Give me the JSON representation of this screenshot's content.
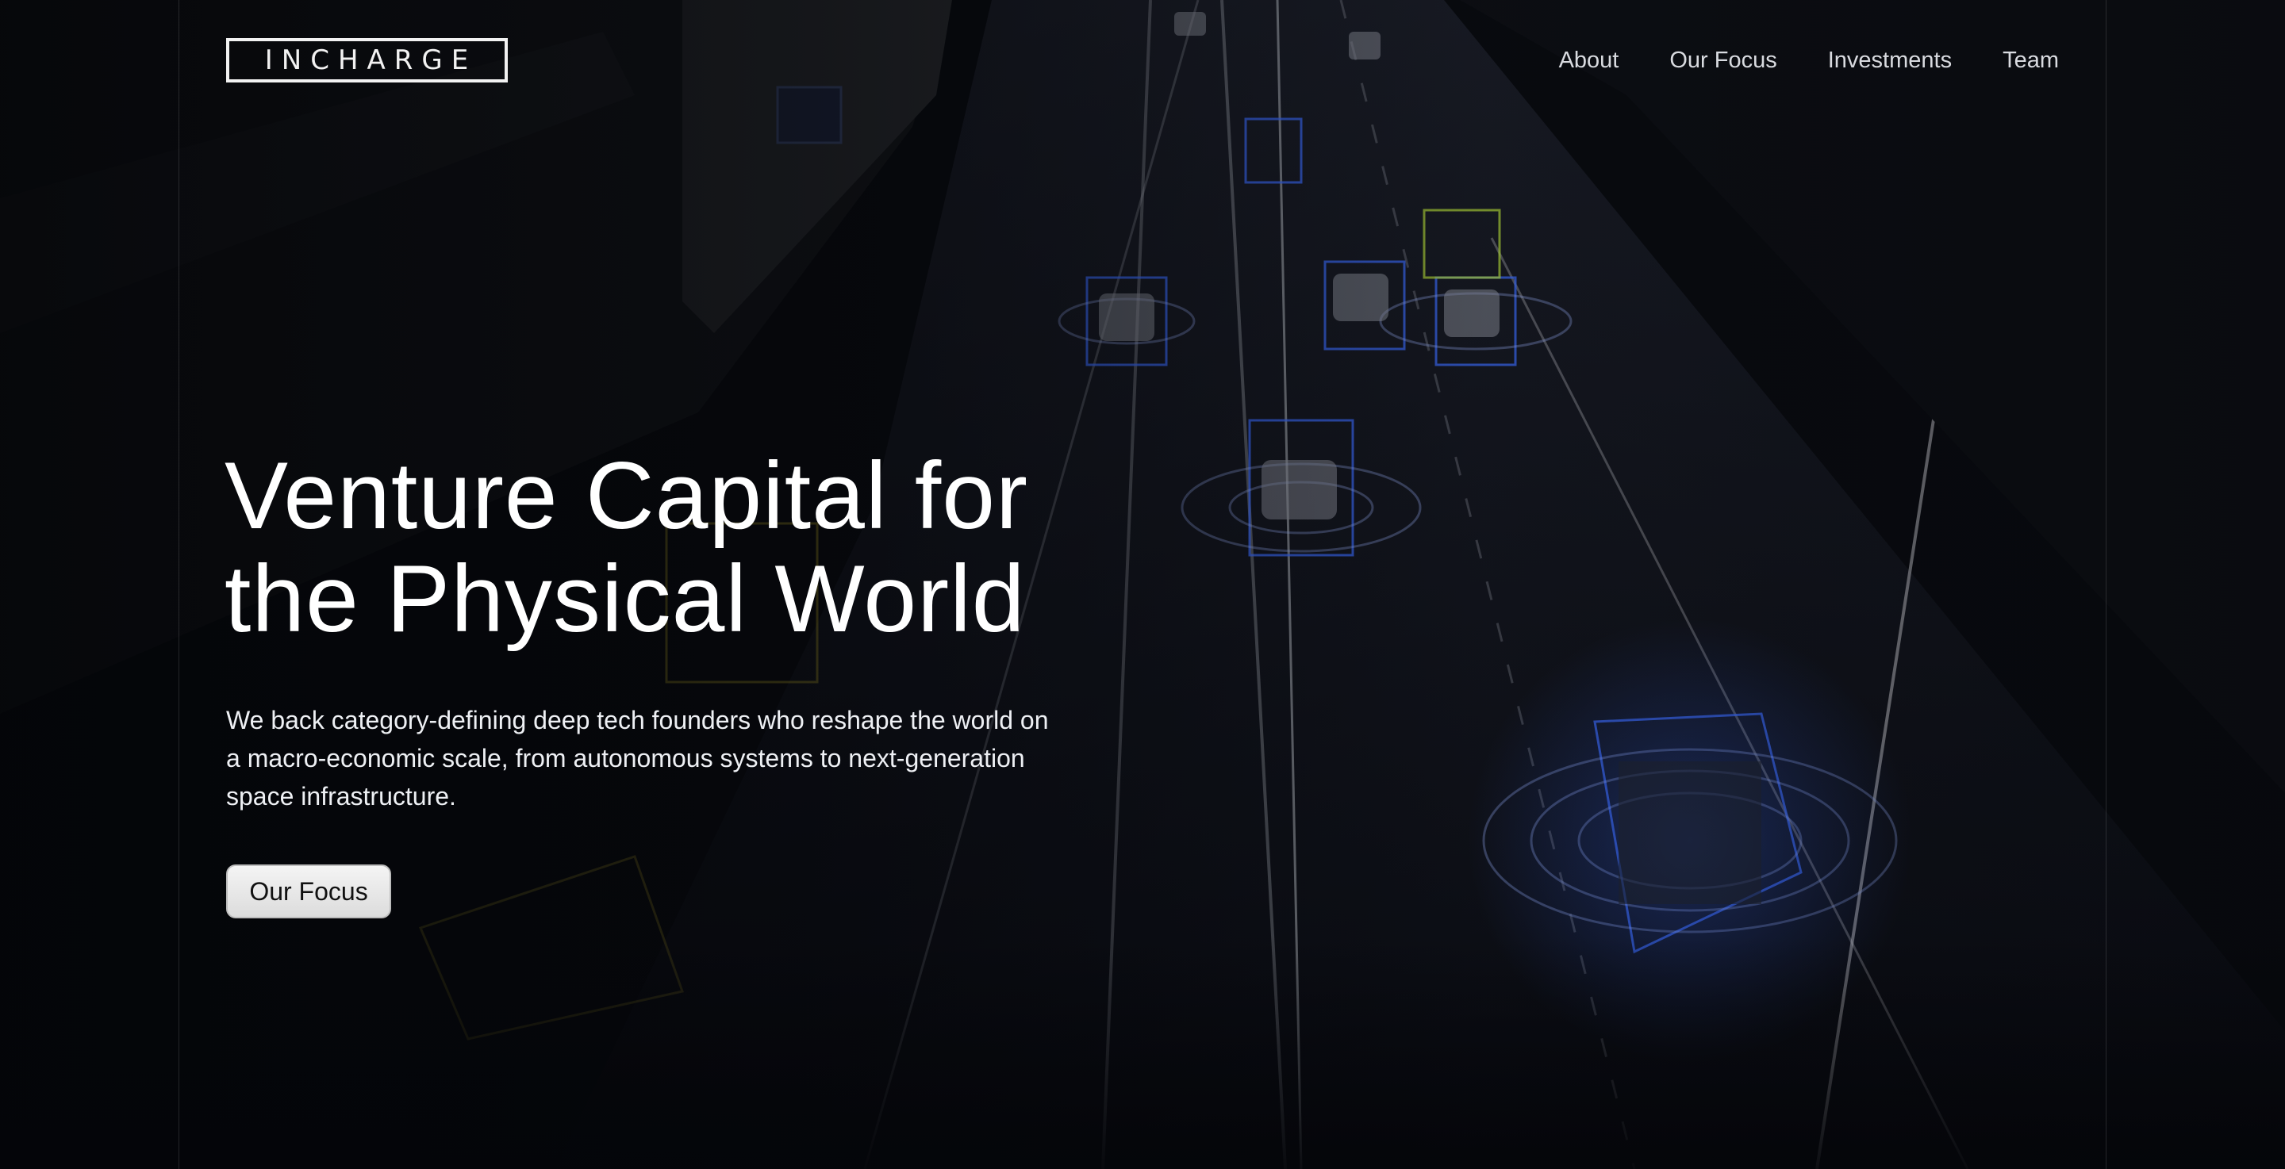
{
  "brand": {
    "logo_text": "INCHARGE"
  },
  "nav": {
    "items": [
      {
        "label": "About"
      },
      {
        "label": "Our Focus"
      },
      {
        "label": "Investments"
      },
      {
        "label": "Team"
      }
    ]
  },
  "hero": {
    "title_line_1": "Venture Capital for",
    "title_line_2": "the Physical World",
    "description": "We back category-defining deep tech founders who reshape the world on a macro-economic scale, from autonomous systems to next-generation space infrastructure.",
    "cta_label": "Our Focus"
  },
  "colors": {
    "background": "#06080d",
    "text": "#ffffff",
    "nav_text": "#d9dbe0",
    "lidar_blue": "#3c6cff",
    "lidar_yellow": "#c8b42a",
    "cta_bg": "#e6e6e6"
  }
}
